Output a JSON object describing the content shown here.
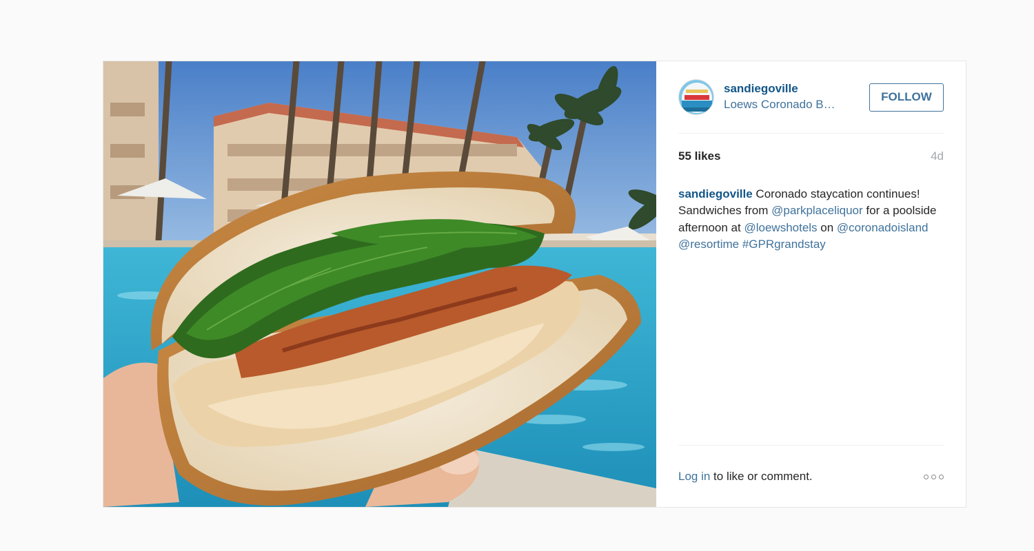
{
  "post": {
    "username": "sandiegoville",
    "location": "Loews Coronado B…",
    "follow_label": "FOLLOW",
    "likes": "55 likes",
    "age": "4d",
    "caption": {
      "user": "sandiegoville",
      "t1": " Coronado staycation continues! Sandwiches from ",
      "m1": "@parkplaceliquor",
      "t2": " for a poolside afternoon at ",
      "m2": "@loewshotels",
      "t3": " on ",
      "m3": "@coronadoisland",
      "t4": " ",
      "m4": "@resortime",
      "t5": " ",
      "h1": "#GPRgrandstay"
    },
    "login": {
      "link1": "Log in",
      "t1": " to like or comment."
    }
  },
  "colors": {
    "link": "#3f729b",
    "username": "#125688",
    "muted": "#a5a7aa"
  },
  "icons": {
    "more": "more-options-icon"
  }
}
